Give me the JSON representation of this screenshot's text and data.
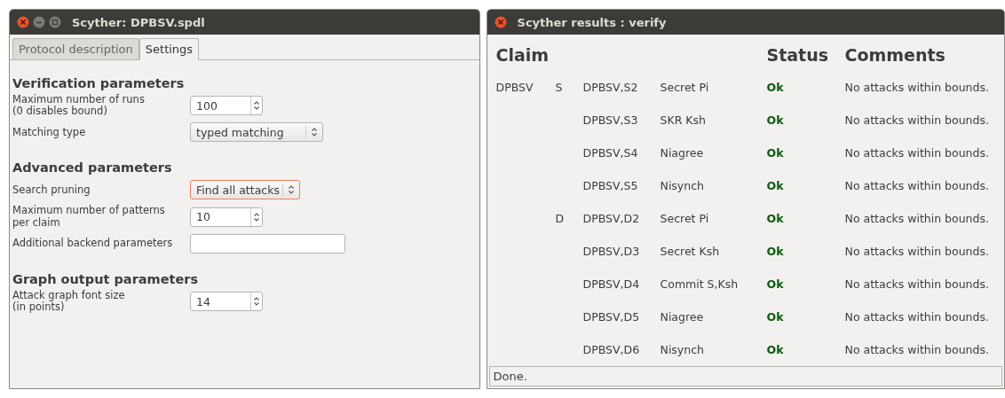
{
  "settings_window": {
    "title": "Scyther: DPBSV.spdl",
    "controls": [
      {
        "kind": "close"
      },
      {
        "kind": "minimize"
      },
      {
        "kind": "maximize"
      }
    ],
    "tabs": [
      {
        "label": "Protocol description",
        "selected": false
      },
      {
        "label": "Settings",
        "selected": true
      }
    ],
    "sections": [
      {
        "heading": "Verification parameters",
        "fields": [
          {
            "label": "Maximum number of runs\n(0 disables bound)",
            "kind": "spin",
            "value": "100",
            "focused": false
          },
          {
            "label": "Matching type",
            "kind": "combo",
            "value": "typed matching",
            "focused": false
          }
        ]
      },
      {
        "heading": "Advanced parameters",
        "fields": [
          {
            "label": "Search pruning",
            "kind": "combo",
            "value": "Find all attacks",
            "focused": true
          },
          {
            "label": "Maximum number of patterns\nper claim",
            "kind": "spin",
            "value": "10",
            "focused": false
          },
          {
            "label": "Additional backend parameters",
            "kind": "text",
            "focused": false
          }
        ]
      },
      {
        "heading": "Graph output parameters",
        "fields": [
          {
            "label": "Attack graph font size\n(in points)",
            "kind": "spin",
            "value": "14",
            "focused": false
          }
        ]
      }
    ]
  },
  "results_window": {
    "title": "Scyther results : verify",
    "controls": [
      {
        "kind": "close"
      }
    ],
    "columns": [
      "Claim",
      "Status",
      "Comments"
    ],
    "rows": [
      {
        "protocol": "DPBSV",
        "role": "S",
        "claim_id": "DPBSV,S2",
        "claim": "Secret Pi",
        "status": "Ok",
        "comment": "No attacks within bounds."
      },
      {
        "claim_id": "DPBSV,S3",
        "claim": "SKR Ksh",
        "status": "Ok",
        "comment": "No attacks within bounds."
      },
      {
        "claim_id": "DPBSV,S4",
        "claim": "Niagree",
        "status": "Ok",
        "comment": "No attacks within bounds."
      },
      {
        "claim_id": "DPBSV,S5",
        "claim": "Nisynch",
        "status": "Ok",
        "comment": "No attacks within bounds."
      },
      {
        "role": "D",
        "claim_id": "DPBSV,D2",
        "claim": "Secret Pi",
        "status": "Ok",
        "comment": "No attacks within bounds."
      },
      {
        "claim_id": "DPBSV,D3",
        "claim": "Secret Ksh",
        "status": "Ok",
        "comment": "No attacks within bounds."
      },
      {
        "claim_id": "DPBSV,D4",
        "claim": "Commit S,Ksh",
        "status": "Ok",
        "comment": "No attacks within bounds."
      },
      {
        "claim_id": "DPBSV,D5",
        "claim": "Niagree",
        "status": "Ok",
        "comment": "No attacks within bounds."
      },
      {
        "claim_id": "DPBSV,D6",
        "claim": "Nisynch",
        "status": "Ok",
        "comment": "No attacks within bounds."
      }
    ],
    "status_bar": "Done."
  }
}
